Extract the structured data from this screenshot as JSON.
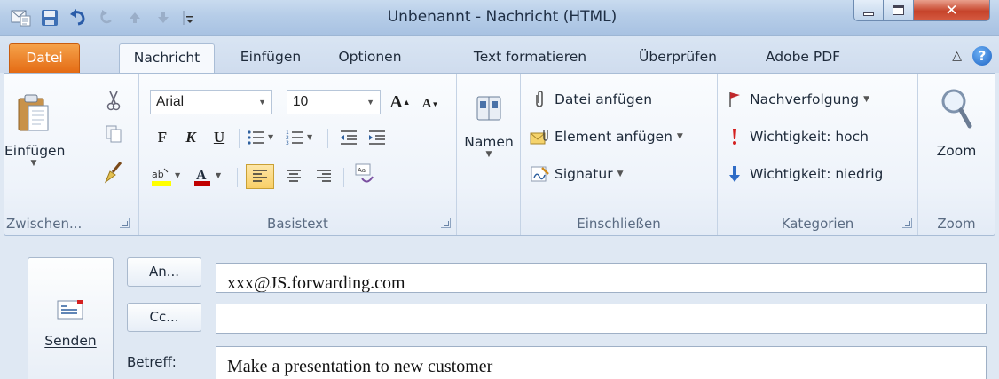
{
  "window": {
    "title": "Unbenannt - Nachricht (HTML)"
  },
  "tabs": [
    "Datei",
    "Nachricht",
    "Einfügen",
    "Optionen",
    "Text formatieren",
    "Überprüfen",
    "Adobe PDF"
  ],
  "ribbon": {
    "clipboard": {
      "paste_label": "Einfügen",
      "group_label": "Zwischen..."
    },
    "basic_text": {
      "font": "Arial",
      "size": "10",
      "group_label": "Basistext"
    },
    "names": {
      "label": "Namen"
    },
    "include": {
      "attach_file": "Datei anfügen",
      "attach_item": "Element anfügen",
      "signature": "Signatur",
      "group_label": "Einschließen"
    },
    "tags": {
      "followup": "Nachverfolgung",
      "importance_high": "Wichtigkeit: hoch",
      "importance_low": "Wichtigkeit: niedrig",
      "group_label": "Kategorien"
    },
    "zoom": {
      "label": "Zoom",
      "group_label": "Zoom"
    }
  },
  "compose": {
    "send_label": "Senden",
    "to_label": "An...",
    "cc_label": "Cc...",
    "subject_label": "Betreff:",
    "to_value": "xxx@JS.forwarding.com",
    "cc_value": "",
    "subject_value": "Make a presentation to new customer"
  },
  "colors": {
    "file_tab": "#e46b14",
    "highlight": "#ffff00",
    "font_color": "#c00000",
    "close_button": "#c6432a"
  }
}
